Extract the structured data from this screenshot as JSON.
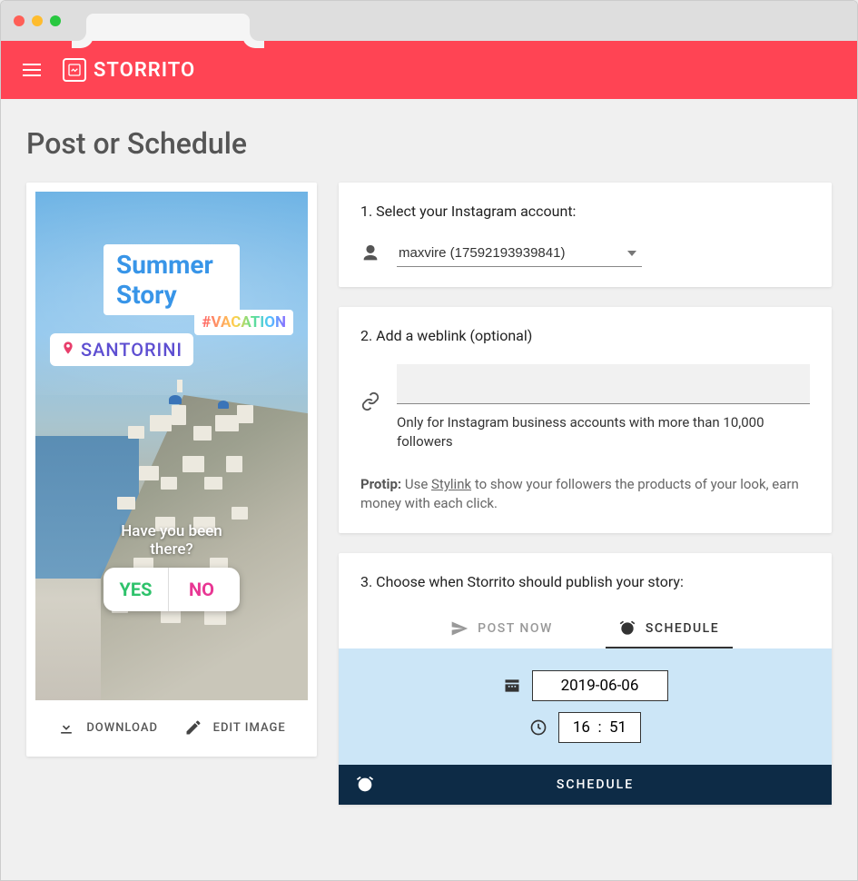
{
  "brand": "STORRITO",
  "page_title": "Post or Schedule",
  "preview": {
    "title_sticker": "Summer Story",
    "hashtag_sticker": "#VACATION",
    "location_sticker": "SANTORINI",
    "poll_question": "Have you been there?",
    "poll_yes": "YES",
    "poll_no": "NO",
    "download_btn": "DOWNLOAD",
    "edit_btn": "EDIT IMAGE"
  },
  "step1": {
    "label": "1. Select your Instagram account:",
    "account": "maxvire (17592193939841)"
  },
  "step2": {
    "label": "2. Add a weblink (optional)",
    "helper": "Only for Instagram business accounts with more than 10,000 followers",
    "protip_prefix": "Protip:",
    "protip_use": " Use ",
    "protip_link": "Stylink",
    "protip_suffix": " to show your followers the products of your look, earn money with each click."
  },
  "step3": {
    "label": "3. Choose when Storrito should publish your story:",
    "tab_post_now": "POST NOW",
    "tab_schedule": "SCHEDULE",
    "date": "2019-06-06",
    "hour": "16",
    "minute": "51",
    "schedule_btn": "SCHEDULE"
  }
}
